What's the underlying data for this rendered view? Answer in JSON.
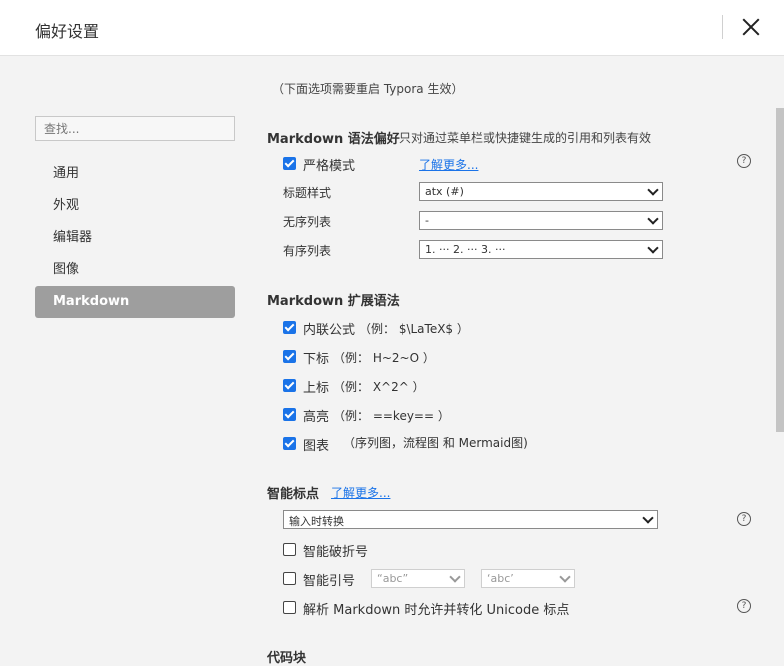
{
  "window": {
    "title": "偏好设置"
  },
  "sidebar": {
    "search_placeholder": "查找...",
    "items": [
      {
        "label": "通用"
      },
      {
        "label": "外观"
      },
      {
        "label": "编辑器"
      },
      {
        "label": "图像"
      },
      {
        "label": "Markdown"
      }
    ],
    "active": "Markdown"
  },
  "main": {
    "notice": "（下面选项需要重启 Typora 生效）",
    "syntax_pref": {
      "title": "Markdown 语法偏好",
      "note": "只对通过菜单栏或快捷键生成的引用和列表有效",
      "strict_mode": {
        "label": "严格模式",
        "checked": true,
        "learn_more": "了解更多..."
      },
      "heading_style": {
        "label": "标题样式",
        "value": "atx (#)"
      },
      "unordered_list": {
        "label": "无序列表",
        "value": "-"
      },
      "ordered_list": {
        "label": "有序列表",
        "value": "1. ··· 2. ··· 3. ···"
      }
    },
    "extended_syntax": {
      "title": "Markdown 扩展语法",
      "items": [
        {
          "label": "内联公式",
          "example": "（例： $\\LaTeX$ ）",
          "checked": true
        },
        {
          "label": "下标",
          "example": "（例： H~2~O ）",
          "checked": true
        },
        {
          "label": "上标",
          "example": "（例： X^2^ ）",
          "checked": true
        },
        {
          "label": "高亮",
          "example": "（例： ==key== ）",
          "checked": true
        },
        {
          "label": "图表",
          "example": "（序列图，流程图 和 Mermaid图)",
          "checked": true
        }
      ]
    },
    "smart_punct": {
      "title": "智能标点",
      "learn_more": "了解更多...",
      "mode": "输入时转换",
      "smart_dash": {
        "label": "智能破折号",
        "checked": false
      },
      "smart_quotes": {
        "label": "智能引号",
        "checked": false,
        "double_quote": "“abc”",
        "single_quote": "‘abc’"
      },
      "unicode_punct": {
        "label": "解析 Markdown 时允许并转化 Unicode 标点",
        "checked": false
      }
    },
    "code_block": {
      "title": "代码块"
    }
  },
  "colors": {
    "accent": "#1a73e8",
    "active_nav": "#9e9e9e",
    "background": "#f3f3f3"
  },
  "icons": {
    "close": "close-icon",
    "help": "help-icon",
    "checkbox": "checkbox-icon",
    "dropdown": "chevron-down-icon"
  }
}
